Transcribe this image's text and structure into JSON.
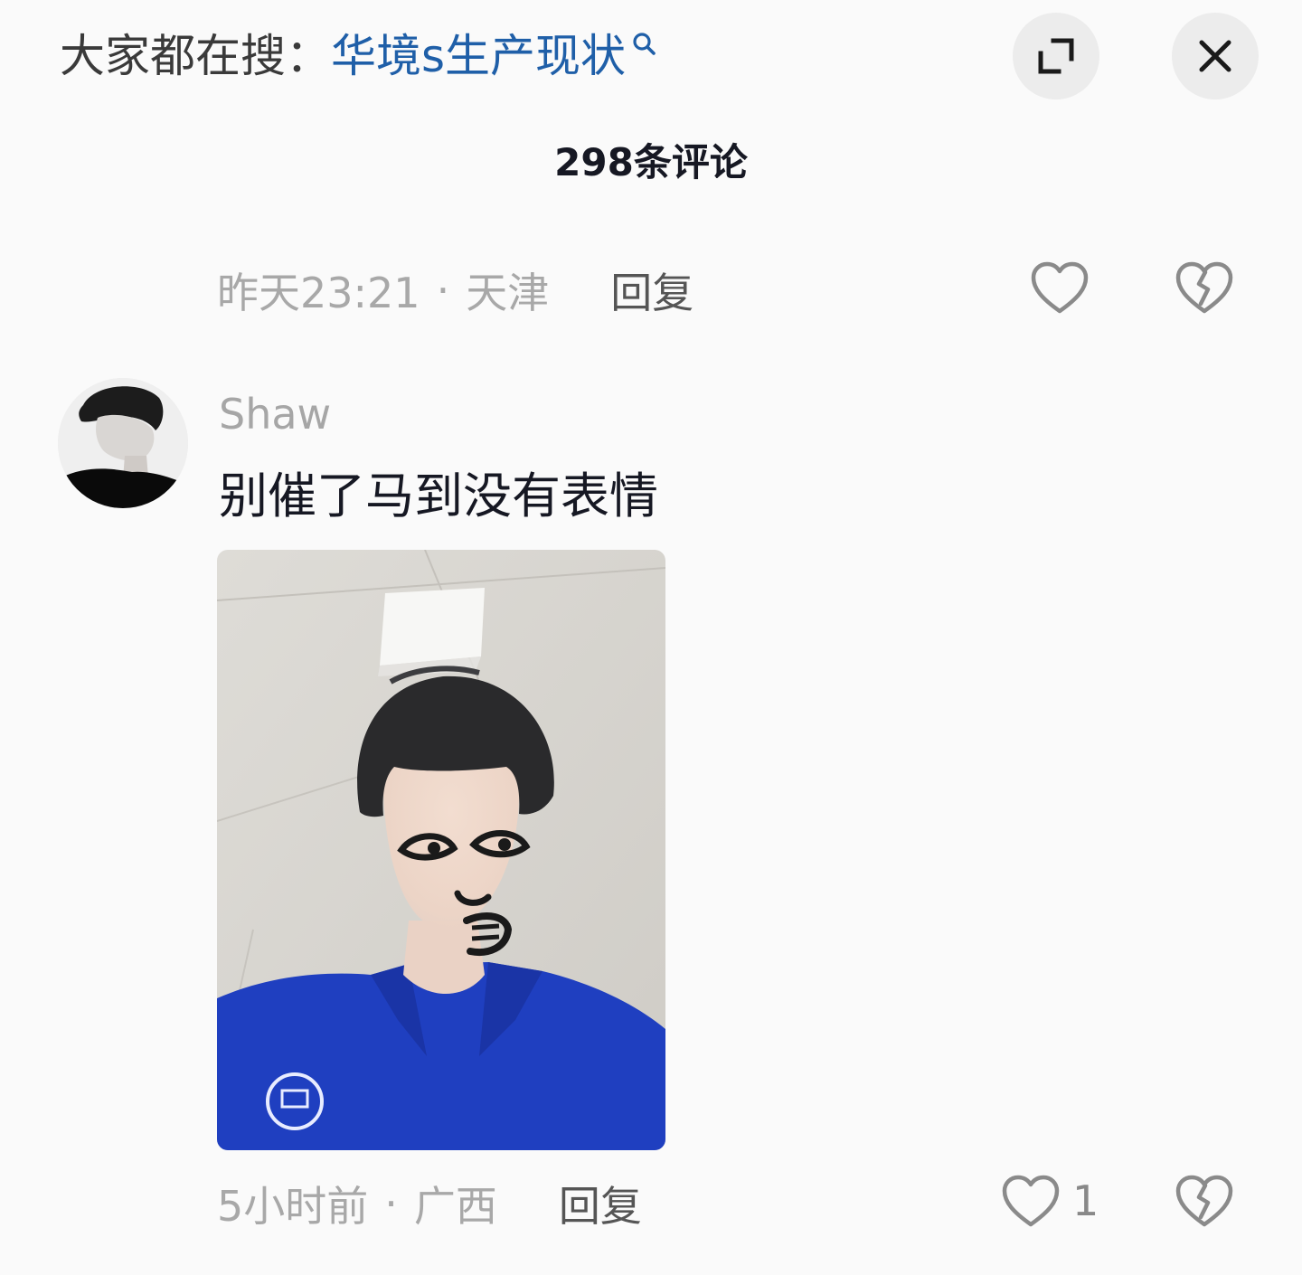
{
  "header": {
    "search_prefix": "大家都在搜：",
    "search_keyword": "华境s生产现状",
    "icons": {
      "search": "search-icon",
      "expand": "expand-icon",
      "close": "close-icon"
    }
  },
  "comment_count": "298条评论",
  "previous_comment": {
    "time": "昨天23:21",
    "separator": "·",
    "location": "天津",
    "reply_label": "回复"
  },
  "comment": {
    "username": "Shaw",
    "text": "别催了马到没有表情",
    "time": "5小时前",
    "separator": "·",
    "location": "广西",
    "reply_label": "回复",
    "like_count": "1"
  },
  "colors": {
    "keyword": "#1f5fa8",
    "meta_gray": "#a8a8a8",
    "shirt_blue": "#1f3fc0"
  }
}
